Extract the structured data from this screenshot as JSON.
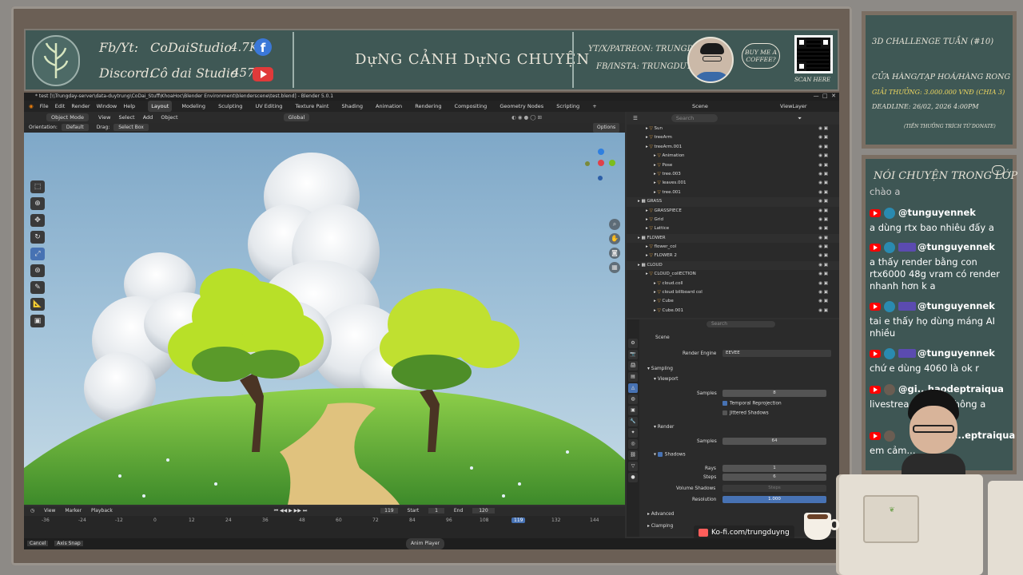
{
  "banner": {
    "fb_yt_label": "Fb/Yt:",
    "fb_yt_name": "CoDaiStudio",
    "fb_count": "4.7K",
    "discord_label": "Discord:",
    "discord_name": "Cô dai Studio",
    "yt_count": "457",
    "title": "DựNG CẢNH DựNG CHUYỆN",
    "yt_handle": "YT/X/PATREON: TRUNGDUYENG",
    "fb_handle": "FB/INSTA: TRUNGDUYTRNG",
    "coffee": "BUY ME A COFFEE?",
    "scan": "SCAN HERE"
  },
  "challenge": {
    "title": "3D CHALLENGE TUẦN (#10)",
    "line1": "CỬA HÀNG/TẠP HOÁ/HÀNG RONG",
    "prize": "GIẢI THƯỞNG: 3.000.000 VNĐ (CHIA 3)",
    "deadline": "DEADLINE: 26/02, 2026 4:00PM",
    "note": "(TIỀN THƯỞNG TRÍCH TỪ DONATE)"
  },
  "chat_board": {
    "title": "NÓI CHUYỆN TRONG LỚP",
    "messages": [
      {
        "user": "",
        "text": "chào a"
      },
      {
        "user": "@tunguyennek",
        "text": "a dùng rtx bao nhiêu đấy a"
      },
      {
        "user": "@tunguyennek",
        "text": "a thấy render bằng con rtx6000 48g vram có render nhanh hơn k a"
      },
      {
        "user": "@tunguyennek",
        "text": "tai e thấy họ dùng máng AI nhiều"
      },
      {
        "user": "@tunguyennek",
        "text": "chứ e dùng 4060 là ok r"
      },
      {
        "user": "@gi...haodeptraiqua",
        "text": "livestrea... có ăn không a"
      },
      {
        "user": "...eptraiqua",
        "text": "em cảm..."
      }
    ]
  },
  "blender": {
    "window_title": "* test [\\\\Trungday-server\\data-duytrung\\CoDai_Stuff\\KhoaHoc\\Blender Environment\\blenderscene\\test.blend] - Blender 5.0.1",
    "menu": [
      "File",
      "Edit",
      "Render",
      "Window",
      "Help"
    ],
    "workspaces": [
      "Layout",
      "Modeling",
      "Sculpting",
      "UV Editing",
      "Texture Paint",
      "Shading",
      "Animation",
      "Rendering",
      "Compositing",
      "Geometry Nodes",
      "Scripting",
      "+"
    ],
    "scene_label": "Scene",
    "viewlayer_label": "ViewLayer",
    "vp_header": {
      "mode": "Object Mode",
      "view": "View",
      "select": "Select",
      "add": "Add",
      "object": "Object",
      "transform": "Global"
    },
    "vp_header2": {
      "orientation_label": "Orientation:",
      "orientation": "Default",
      "drag_label": "Drag:",
      "drag": "Select Box",
      "options": "Options"
    },
    "timeline": {
      "view": "View",
      "marker": "Marker",
      "playback": "Playback",
      "current_frame": "119",
      "start_label": "Start",
      "start": "1",
      "end_label": "End",
      "end": "120",
      "ticks": [
        "-36",
        "-24",
        "-12",
        "0",
        "12",
        "24",
        "36",
        "48",
        "60",
        "72",
        "84",
        "96",
        "108",
        "119",
        "132",
        "144"
      ]
    },
    "status": {
      "cancel": "Cancel",
      "axis_snap": "Axis Snap",
      "anim_player": "Anim Player"
    },
    "outliner": {
      "search_placeholder": "Search",
      "rows": [
        {
          "indent": 1,
          "name": "Sun"
        },
        {
          "indent": 1,
          "name": "treeArm"
        },
        {
          "indent": 1,
          "name": "treeArm.001"
        },
        {
          "indent": 2,
          "name": "Animation"
        },
        {
          "indent": 2,
          "name": "Pose"
        },
        {
          "indent": 2,
          "name": "tree.003"
        },
        {
          "indent": 2,
          "name": "leaves.001"
        },
        {
          "indent": 2,
          "name": "tree.001"
        },
        {
          "indent": 0,
          "name": "GRASS"
        },
        {
          "indent": 1,
          "name": "GRASSPIECE"
        },
        {
          "indent": 1,
          "name": "Grid"
        },
        {
          "indent": 1,
          "name": "Lattice"
        },
        {
          "indent": 0,
          "name": "FLOWER"
        },
        {
          "indent": 1,
          "name": "flower_col"
        },
        {
          "indent": 1,
          "name": "FLOWER 2"
        },
        {
          "indent": 0,
          "name": "CLOUD"
        },
        {
          "indent": 1,
          "name": "CLOUD_collECTION"
        },
        {
          "indent": 2,
          "name": "cloud.coll"
        },
        {
          "indent": 2,
          "name": "cloud billboard col"
        },
        {
          "indent": 2,
          "name": "Cube"
        },
        {
          "indent": 2,
          "name": "Cube.001"
        }
      ]
    },
    "properties": {
      "search_placeholder": "Search",
      "scene": "Scene",
      "render_engine_label": "Render Engine",
      "render_engine": "EEVEE",
      "sampling": "Sampling",
      "viewport": "Viewport",
      "samples_label": "Samples",
      "viewport_samples": "8",
      "temporal": "Temporal Reprojection",
      "jittered": "Jittered Shadows",
      "render": "Render",
      "render_samples": "64",
      "shadows": "Shadows",
      "rays_label": "Rays",
      "rays": "1",
      "steps_label": "Steps",
      "steps": "6",
      "volume_shadows": "Volume Shadows",
      "vol_steps": "Steps",
      "resolution_label": "Resolution",
      "resolution": "1.000",
      "advanced": "Advanced",
      "clamping": "Clamping"
    },
    "kofi": "Ko-fi.com/trungduyng"
  },
  "colors": {
    "accent": "#4772b3",
    "chalk": "#3f5855",
    "yt_red": "#ff0000"
  }
}
